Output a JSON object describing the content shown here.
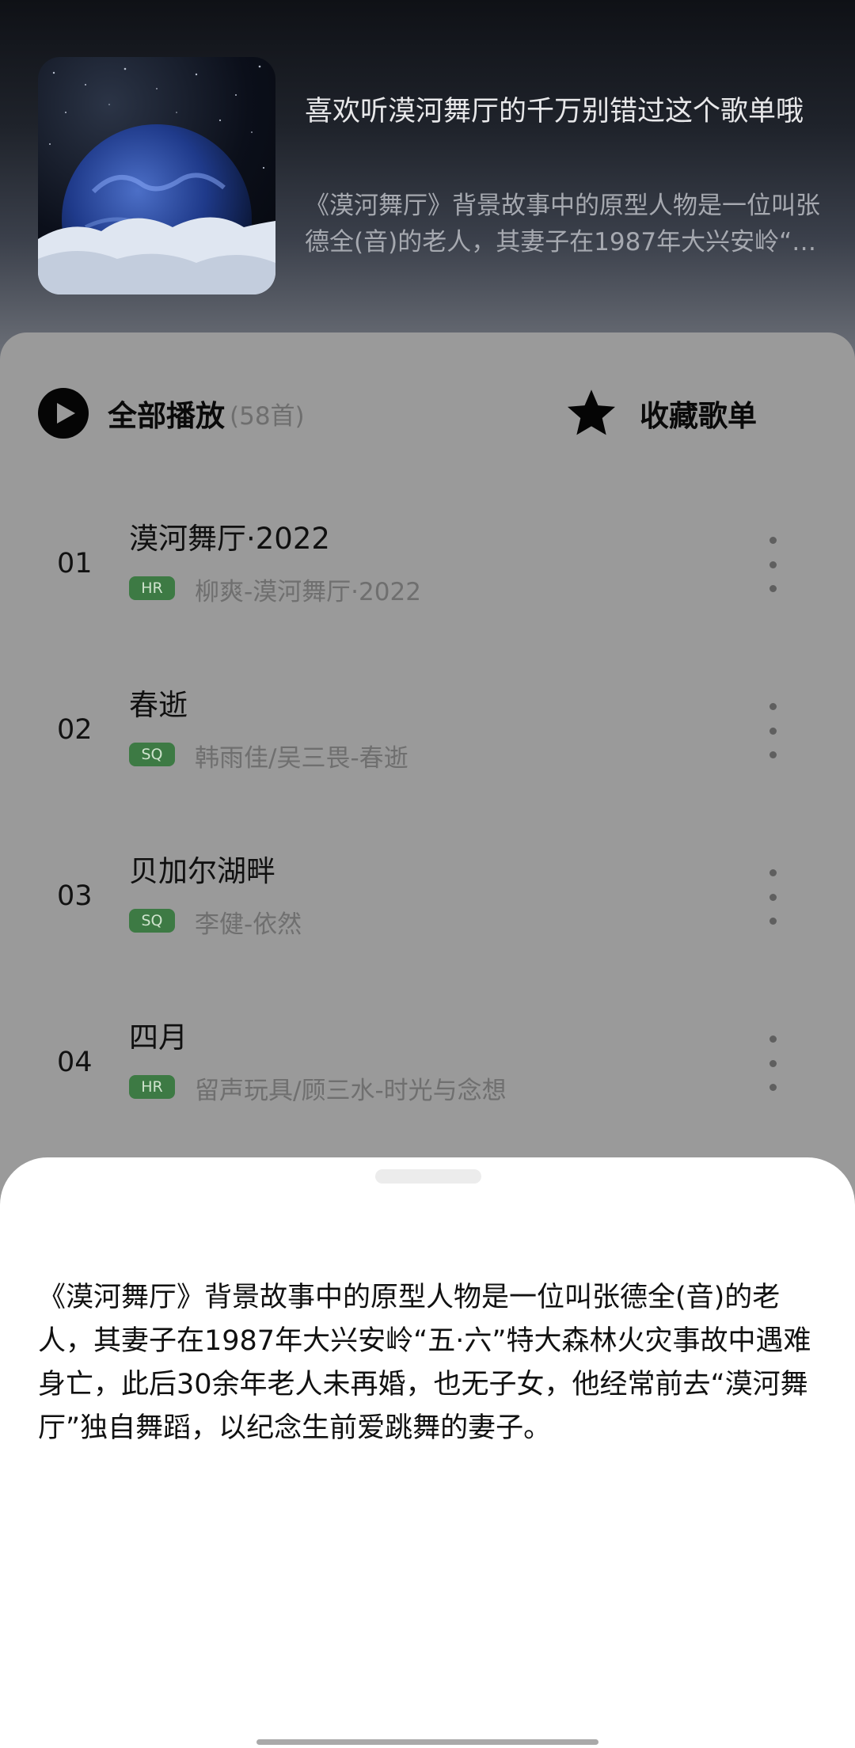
{
  "playlist": {
    "title": "喜欢听漠河舞厅的千万别错过这个歌单哦",
    "description": "《漠河舞厅》背景故事中的原型人物是一位叫张德全(音)的老人，其妻子在1987年大兴安岭“五·六”特大森林火灾事故中遇难身亡，此后30余年老人未再婚，也无子女，他经常前去“漠河舞厅”独自舞蹈，以纪念生前爱跳舞的妻子。"
  },
  "actions": {
    "play_all_label": "全部播放",
    "play_all_count": "(58首)",
    "favorite_label": "收藏歌单"
  },
  "tracks": [
    {
      "num": "01",
      "title": "漠河舞厅·2022",
      "badge": "HR",
      "subtitle": "柳爽-漠河舞厅·2022"
    },
    {
      "num": "02",
      "title": "春逝",
      "badge": "SQ",
      "subtitle": "韩雨佳/吴三畏-春逝"
    },
    {
      "num": "03",
      "title": "贝加尔湖畔",
      "badge": "SQ",
      "subtitle": "李健-依然"
    },
    {
      "num": "04",
      "title": "四月",
      "badge": "HR",
      "subtitle": "留声玩具/顾三水-时光与念想"
    }
  ],
  "sheet": {
    "text": "《漠河舞厅》背景故事中的原型人物是一位叫张德全(音)的老人，其妻子在1987年大兴安岭“五·六”特大森林火灾事故中遇难身亡，此后30余年老人未再婚，也无子女，他经常前去“漠河舞厅”独自舞蹈，以纪念生前爱跳舞的妻子。"
  },
  "icons": {
    "cover": "planet-cover-image",
    "play": "play-circle-icon",
    "favorite": "star-icon",
    "more": "more-vertical-icon"
  }
}
